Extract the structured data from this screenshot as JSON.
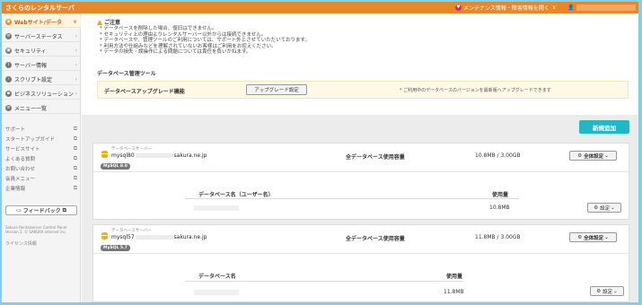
{
  "topbar": {
    "brand": "さくらのレンタルサーバ",
    "maintenance_label": "メンテナンス情報・障害情報を開く",
    "maintenance_chevron": "∨",
    "user_icon": "user-icon"
  },
  "sidebar": {
    "nav": [
      {
        "label": "Webサイト/データ",
        "icon": "globe-icon",
        "color": "#e8862a",
        "glyph": "◉",
        "active": true
      },
      {
        "label": "サーバーステータス",
        "icon": "server-icon",
        "color": "#777",
        "glyph": "≡",
        "active": false
      },
      {
        "label": "セキュリティ",
        "icon": "lock-icon",
        "color": "#777",
        "glyph": "▣",
        "active": false
      },
      {
        "label": "サーバー情報",
        "icon": "info-icon",
        "color": "#777",
        "glyph": "i",
        "active": false
      },
      {
        "label": "スクリプト設定",
        "icon": "script-icon",
        "color": "#777",
        "glyph": "<",
        "active": false
      },
      {
        "label": "ビジネスソリューション",
        "icon": "briefcase-icon",
        "color": "#777",
        "glyph": "▪",
        "active": false
      },
      {
        "label": "メニュー一覧",
        "icon": "menu-icon",
        "color": "#777",
        "glyph": "≡",
        "active": false
      }
    ],
    "links": [
      {
        "label": "サポート"
      },
      {
        "label": "スタートアップガイド"
      },
      {
        "label": "サービスサイト"
      },
      {
        "label": "よくある質問"
      },
      {
        "label": "お問い合わせ"
      },
      {
        "label": "会員メニュー"
      },
      {
        "label": "企業情報"
      }
    ],
    "feedback_label": "フィードバック",
    "copyright": "Sakura Rentalserver Control Panel Version 2. © SAKURA internet inc.",
    "license": "ライセンス情報"
  },
  "notice": {
    "title": "ご注意",
    "items": [
      "データベースを削除した場合、復旧はできません。",
      "セキュリティ上の理由よりレンタルサーバー以外からは接続できません。",
      "データベースや、管理ツールのご利用については、サポート外とさせていただいております。",
      "利用方法や仕組みなどを理解されていないお客様はご利用をお控えください。",
      "データの損失・誤操作による問題については責任を負いかねます。"
    ]
  },
  "tools": {
    "section_title": "データベース管理ツール",
    "upgrade_label": "データベースアップグレード機能",
    "upgrade_button": "アップグレード設定",
    "upgrade_hint": "* ご利用中のデータベースのバージョンを最新版へアップグレードできます"
  },
  "new_button": "新規追加",
  "db_servers": [
    {
      "label": "データベースサーバー",
      "host_prefix": "mysql80",
      "host_suffix": "sakura.ne.jp",
      "version": "MySQL 8.0",
      "usage_label": "全データベース使用容量",
      "usage_value": "10.8MB / 3.00GB",
      "settings_all": "全体設定",
      "col_name": "データベース名（ユーザー名）",
      "col_usage": "使用量",
      "db_usage": "10.8MB",
      "settings": "設定"
    },
    {
      "label": "データベースサーバー",
      "host_prefix": "mysql57",
      "host_suffix": "sakura.ne.jp",
      "version": "MySQL 5.7",
      "usage_label": "全データベース使用容量",
      "usage_value": "11.8MB / 3.00GB",
      "settings_all": "全体設定",
      "col_name": "データベース名",
      "col_usage": "使用量",
      "db_usage": "11.8MB",
      "settings": "設定"
    }
  ]
}
